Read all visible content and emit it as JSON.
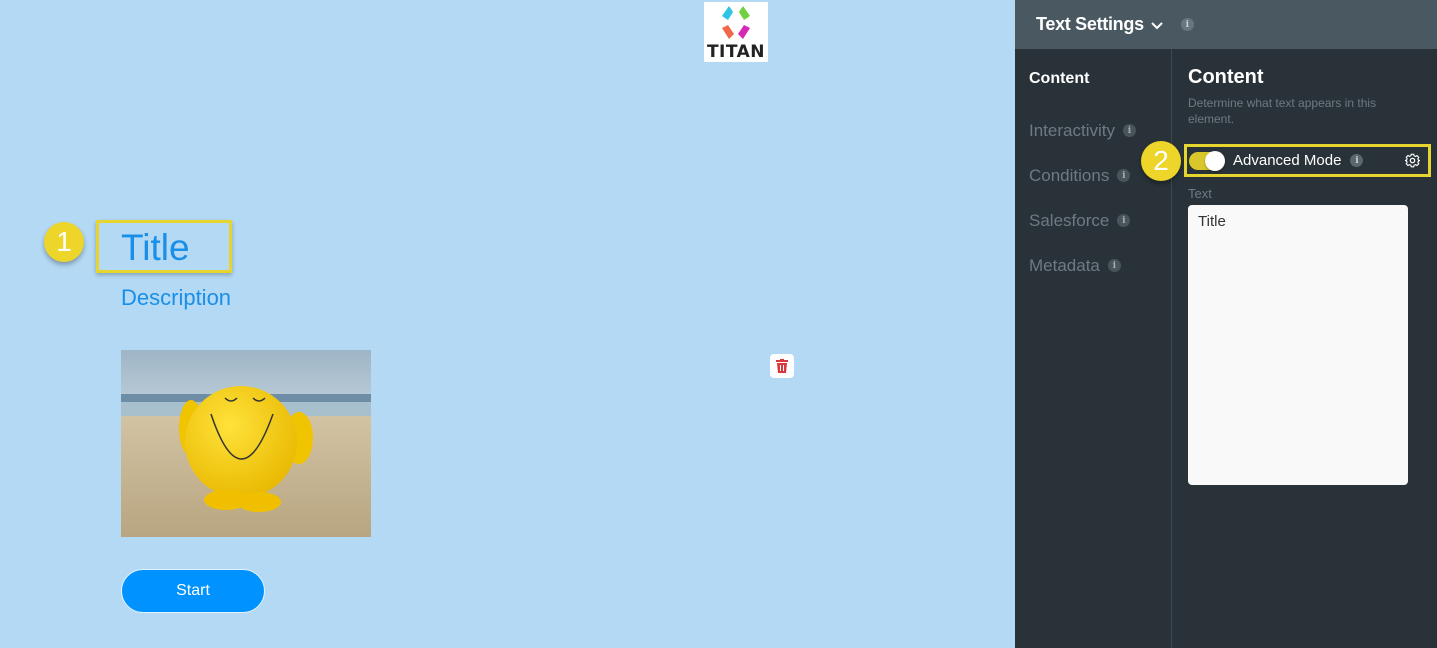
{
  "canvas": {
    "logo": {
      "text": "TITAN",
      "icon": "titan-logo-icon"
    },
    "title": "Title",
    "description": "Description",
    "image": {
      "alt": "Yellow smiley figure on beach",
      "icon": "image-smiley"
    },
    "delete_icon": "trash-icon",
    "start_button": "Start",
    "callouts": {
      "one": "1",
      "two": "2"
    }
  },
  "panel": {
    "header": {
      "title": "Text Settings",
      "chevron_icon": "chevron-down-icon",
      "info_icon": "info-icon"
    },
    "nav": [
      {
        "label": "Content",
        "active": true,
        "has_info": false
      },
      {
        "label": "Interactivity",
        "active": false,
        "has_info": true
      },
      {
        "label": "Conditions",
        "active": false,
        "has_info": true
      },
      {
        "label": "Salesforce",
        "active": false,
        "has_info": true
      },
      {
        "label": "Metadata",
        "active": false,
        "has_info": true
      }
    ],
    "content": {
      "title": "Content",
      "description": "Determine what text appears in this element.",
      "advanced_mode": {
        "label": "Advanced Mode",
        "enabled": true
      },
      "text_label": "Text",
      "text_value": "Title"
    },
    "info_glyph": "i"
  },
  "colors": {
    "canvas_bg": "#b3d9f4",
    "accent_blue": "#0092ff",
    "text_blue": "#1a8fe8",
    "highlight_yellow": "#e6d52e",
    "panel_bg": "#283238",
    "panel_header": "#4a5961"
  }
}
